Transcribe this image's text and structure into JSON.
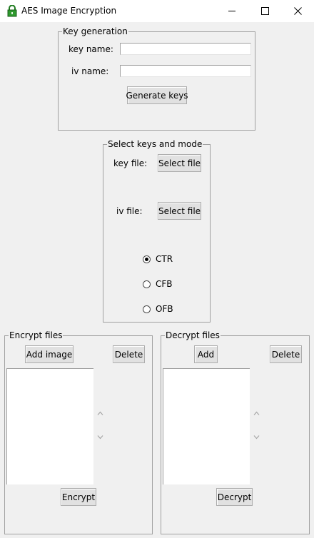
{
  "window": {
    "title": "AES Image Encryption",
    "icons": {
      "app": "lock-icon",
      "minimize": "minimize-icon",
      "maximize": "maximize-icon",
      "close": "close-icon"
    }
  },
  "key_generation": {
    "group_label": "Key generation",
    "key_name_label": "key name:",
    "key_name_value": "",
    "iv_name_label": "iv name:",
    "iv_name_value": "",
    "generate_button": "Generate keys"
  },
  "select_keys": {
    "group_label": "Select keys and mode",
    "key_file_label": "key file:",
    "key_file_button": "Select file",
    "iv_file_label": "iv file:",
    "iv_file_button": "Select file",
    "modes": [
      {
        "label": "CTR",
        "selected": true
      },
      {
        "label": "CFB",
        "selected": false
      },
      {
        "label": "OFB",
        "selected": false
      }
    ]
  },
  "encrypt_files": {
    "group_label": "Encrypt files",
    "add_button": "Add image",
    "delete_button": "Delete",
    "action_button": "Encrypt",
    "files": []
  },
  "decrypt_files": {
    "group_label": "Decrypt files",
    "add_button": "Add",
    "delete_button": "Delete",
    "action_button": "Decrypt",
    "files": []
  }
}
